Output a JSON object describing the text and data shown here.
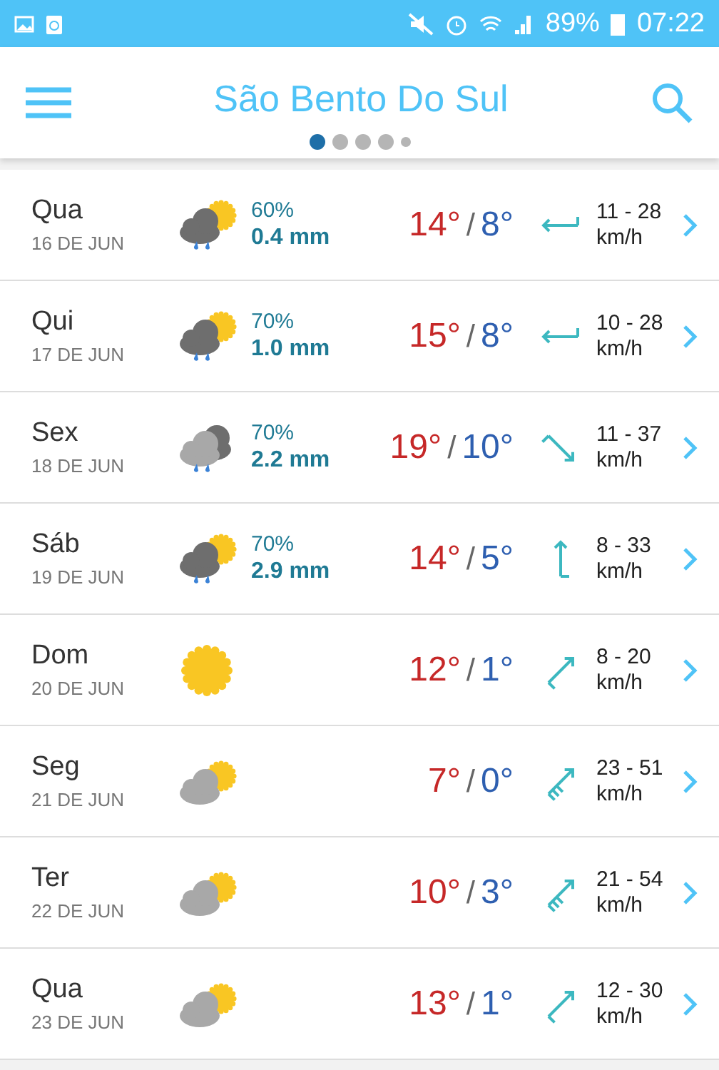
{
  "status_bar": {
    "battery": "89%",
    "time": "07:22"
  },
  "app_bar": {
    "title": "São Bento Do Sul",
    "pages": [
      {
        "kind": "page",
        "selected": true
      },
      {
        "kind": "page",
        "selected": false
      },
      {
        "kind": "page",
        "selected": false
      },
      {
        "kind": "page",
        "selected": false
      },
      {
        "kind": "more",
        "selected": false
      }
    ]
  },
  "days": [
    {
      "day": "Qua",
      "date": "16 DE JUN",
      "kind": "rain-partly",
      "rain_chance": "60%",
      "rain_amount": "0.4 mm",
      "high": "14°",
      "separator": "/",
      "low": "8°",
      "wind_arrow": {
        "kind": "west",
        "strong": false
      },
      "wind": "11 - 28",
      "wind_unit": "km/h"
    },
    {
      "day": "Qui",
      "date": "17 DE JUN",
      "kind": "rain-partly",
      "rain_chance": "70%",
      "rain_amount": "1.0 mm",
      "high": "15°",
      "separator": "/",
      "low": "8°",
      "wind_arrow": {
        "kind": "west",
        "strong": false
      },
      "wind": "10 - 28",
      "wind_unit": "km/h"
    },
    {
      "day": "Sex",
      "date": "18 DE JUN",
      "kind": "rain-cloudy",
      "rain_chance": "70%",
      "rain_amount": "2.2 mm",
      "high": "19°",
      "separator": "/",
      "low": "10°",
      "wind_arrow": {
        "kind": "southeast",
        "strong": false
      },
      "wind": "11 - 37",
      "wind_unit": "km/h"
    },
    {
      "day": "Sáb",
      "date": "19 DE JUN",
      "kind": "rain-partly",
      "rain_chance": "70%",
      "rain_amount": "2.9 mm",
      "high": "14°",
      "separator": "/",
      "low": "5°",
      "wind_arrow": {
        "kind": "north",
        "strong": false
      },
      "wind": "8 - 33",
      "wind_unit": "km/h"
    },
    {
      "day": "Dom",
      "date": "20 DE JUN",
      "kind": "sunny",
      "high": "12°",
      "separator": "/",
      "low": "1°",
      "wind_arrow": {
        "kind": "northeast",
        "strong": false
      },
      "wind": "8 - 20",
      "wind_unit": "km/h"
    },
    {
      "day": "Seg",
      "date": "21 DE JUN",
      "kind": "partly-cloudy",
      "high": "7°",
      "separator": "/",
      "low": "0°",
      "wind_arrow": {
        "kind": "northeast",
        "strong": true
      },
      "wind": "23 - 51",
      "wind_unit": "km/h"
    },
    {
      "day": "Ter",
      "date": "22 DE JUN",
      "kind": "partly-cloudy",
      "high": "10°",
      "separator": "/",
      "low": "3°",
      "wind_arrow": {
        "kind": "northeast",
        "strong": true
      },
      "wind": "21 - 54",
      "wind_unit": "km/h"
    },
    {
      "day": "Qua",
      "date": "23 DE JUN",
      "kind": "partly-cloudy",
      "high": "13°",
      "separator": "/",
      "low": "1°",
      "wind_arrow": {
        "kind": "northeast",
        "strong": false
      },
      "wind": "12 - 30",
      "wind_unit": "km/h"
    }
  ]
}
